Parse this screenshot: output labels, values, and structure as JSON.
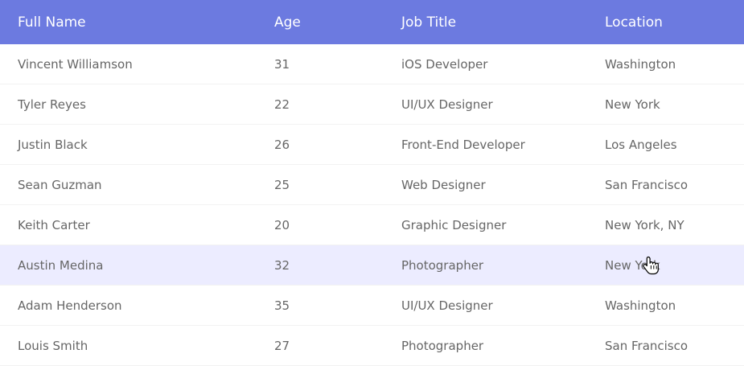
{
  "table": {
    "header": {
      "full_name": "Full Name",
      "age": "Age",
      "job_title": "Job Title",
      "location": "Location"
    },
    "rows": [
      {
        "name": "Vincent Williamson",
        "age": "31",
        "job": "iOS Developer",
        "location": "Washington"
      },
      {
        "name": "Tyler Reyes",
        "age": "22",
        "job": "UI/UX Designer",
        "location": "New York"
      },
      {
        "name": "Justin Black",
        "age": "26",
        "job": "Front-End Developer",
        "location": "Los Angeles"
      },
      {
        "name": "Sean Guzman",
        "age": "25",
        "job": "Web Designer",
        "location": "San Francisco"
      },
      {
        "name": "Keith Carter",
        "age": "20",
        "job": "Graphic Designer",
        "location": "New York, NY"
      },
      {
        "name": "Austin Medina",
        "age": "32",
        "job": "Photographer",
        "location": "New York"
      },
      {
        "name": "Adam Henderson",
        "age": "35",
        "job": "UI/UX Designer",
        "location": "Washington"
      },
      {
        "name": "Louis Smith",
        "age": "27",
        "job": "Photographer",
        "location": "San Francisco"
      }
    ],
    "hovered_row_index": 5
  },
  "colors": {
    "header_bg": "#6c7ae0",
    "header_text": "#ffffff",
    "row_text": "#666666",
    "hover_bg": "#ececff",
    "divider": "#f2f2f2"
  },
  "icons": {
    "cursor": "hand-pointer-icon"
  }
}
